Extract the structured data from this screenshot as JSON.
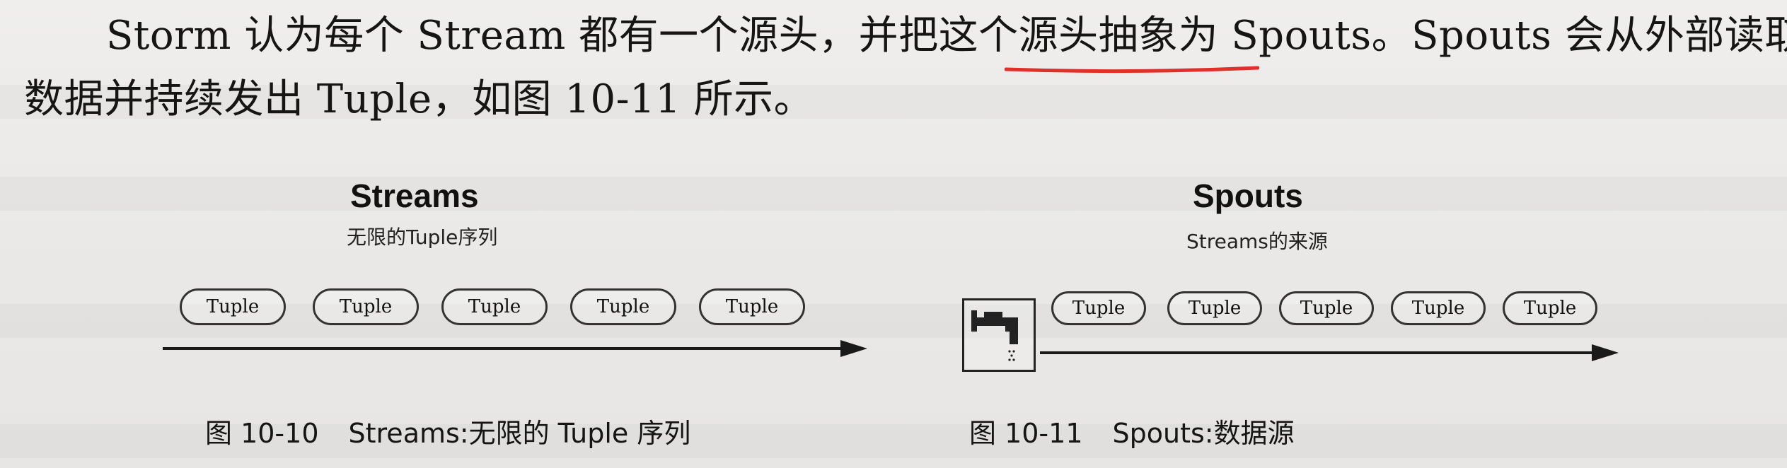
{
  "paragraph": {
    "line1": "Storm 认为每个 Stream 都有一个源头，并把这个源头抽象为 Spouts。Spouts 会从外部读取流",
    "line2": "数据并持续发出 Tuple，如图 10-11 所示。"
  },
  "figure_left": {
    "title": "Streams",
    "subtitle": "无限的Tuple序列",
    "tuples": [
      "Tuple",
      "Tuple",
      "Tuple",
      "Tuple",
      "Tuple"
    ],
    "caption_number": "图 10-10",
    "caption_text": "Streams:无限的 Tuple 序列"
  },
  "figure_right": {
    "title": "Spouts",
    "subtitle": "Streams的来源",
    "tuples": [
      "Tuple",
      "Tuple",
      "Tuple",
      "Tuple",
      "Tuple"
    ],
    "caption_number": "图 10-11",
    "caption_text": "Spouts:数据源",
    "source_icon": "faucet-icon"
  },
  "colors": {
    "underline": "#e0302b",
    "arrow": "#1a1a1a",
    "page_background": "#ecebe9"
  }
}
